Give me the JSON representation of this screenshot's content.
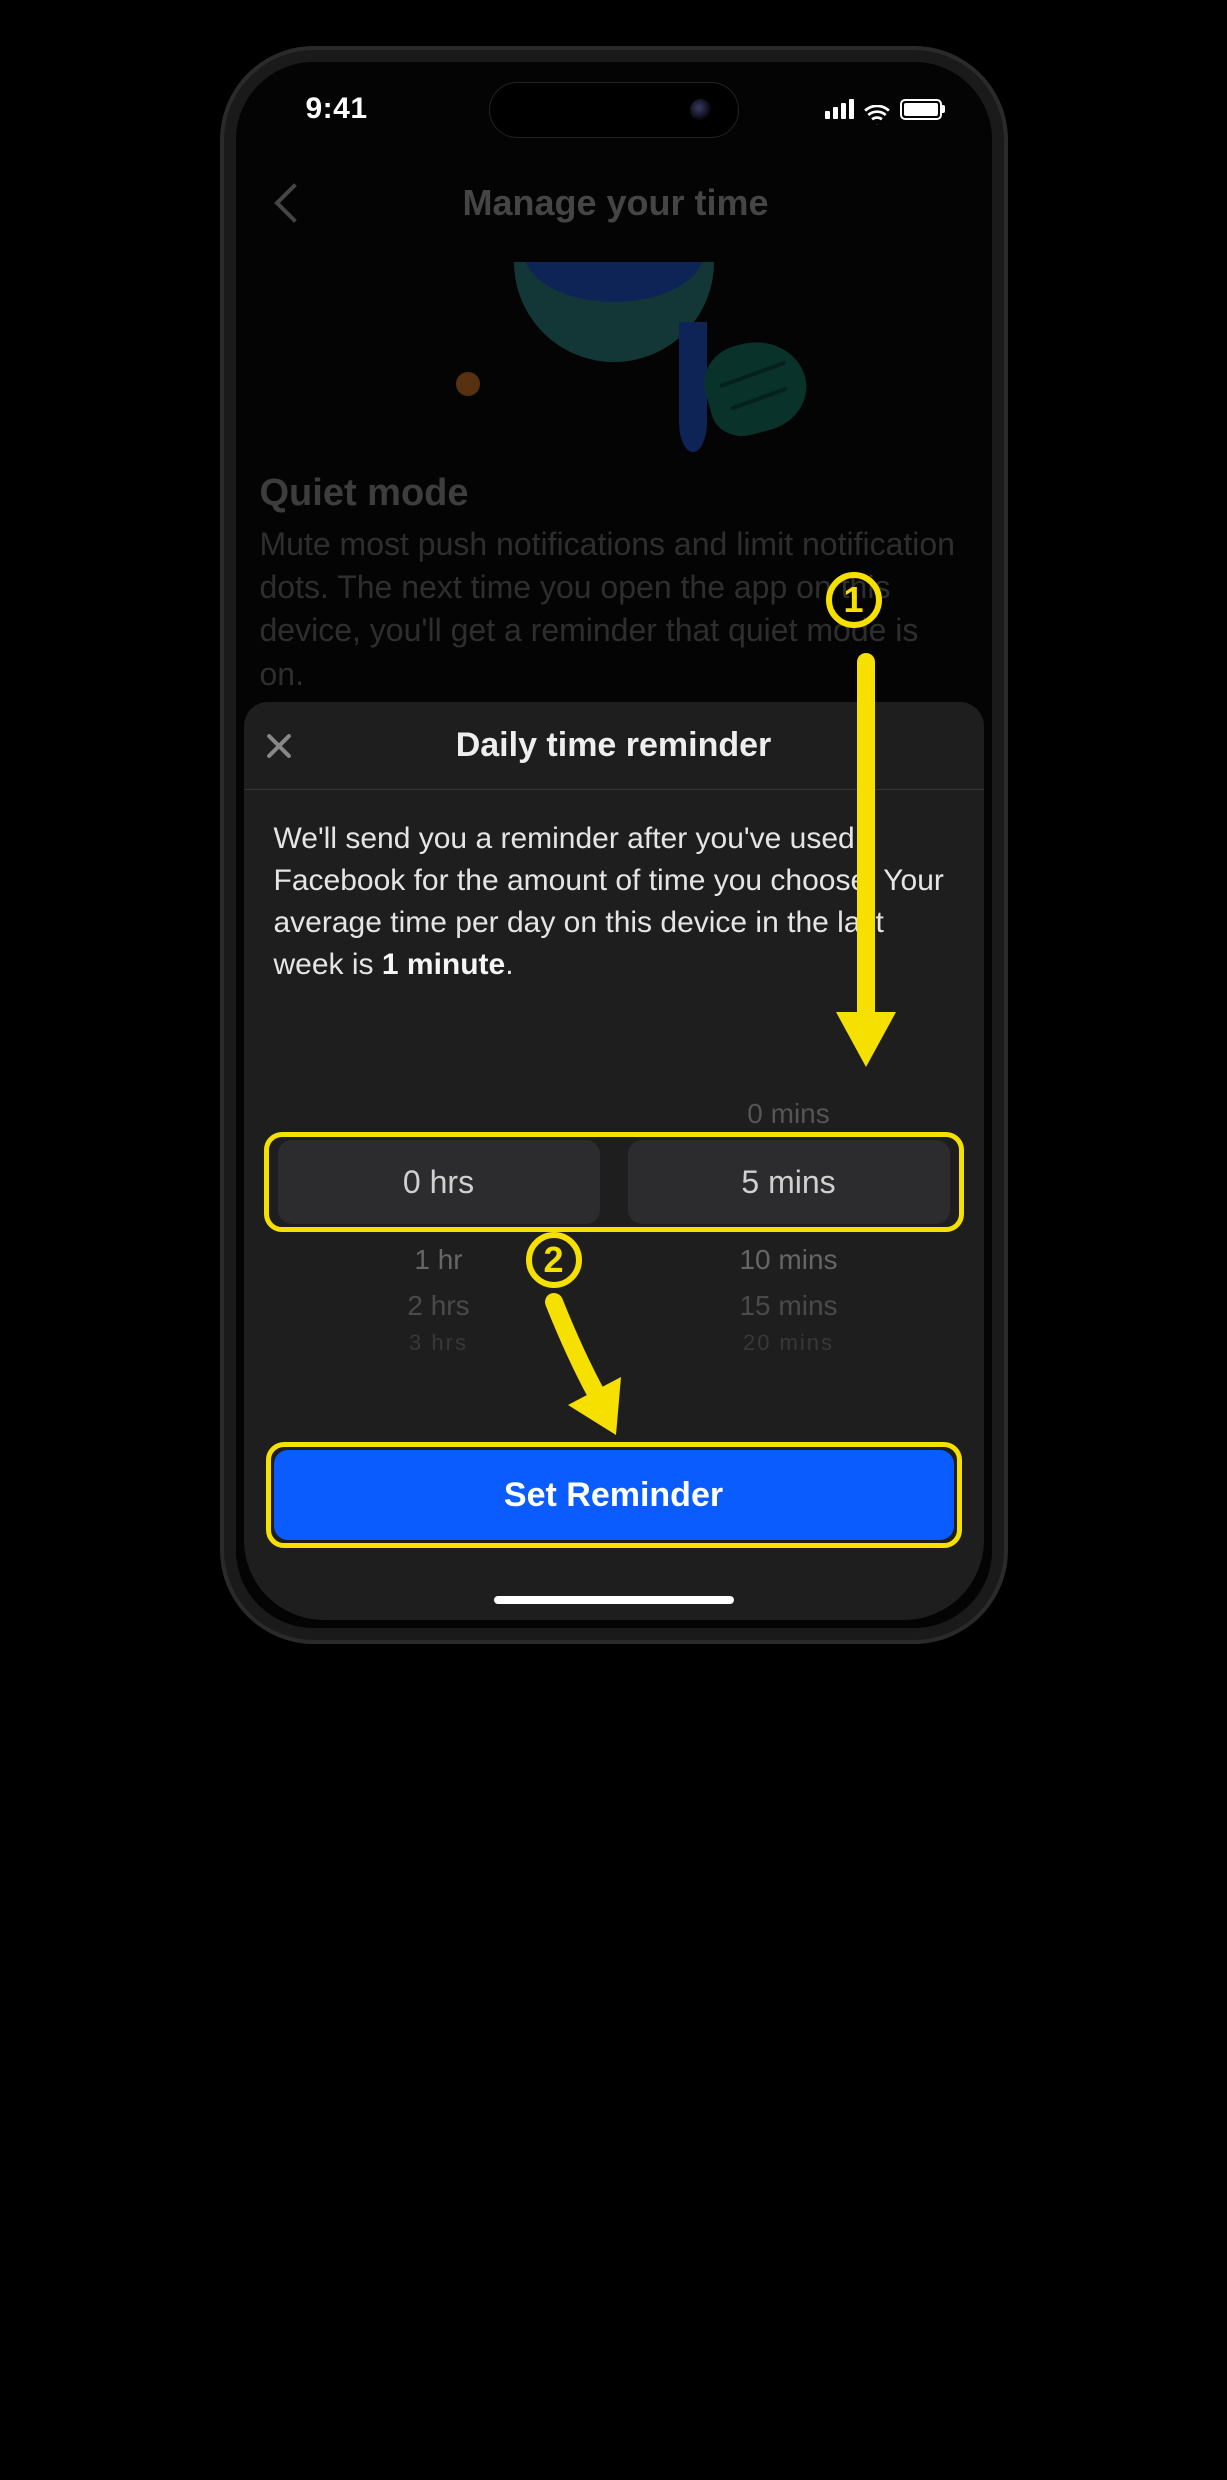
{
  "status_bar": {
    "time": "9:41"
  },
  "header": {
    "title": "Manage your time"
  },
  "quiet_mode": {
    "title": "Quiet mode",
    "description": "Mute most push notifications and limit notification dots. The next time you open the app on this device, you'll get a reminder that quiet mode is on."
  },
  "sheet": {
    "title": "Daily time reminder",
    "body_prefix": "We'll send you a reminder after you've used Facebook for the amount of time you choose. Your average time per day on this device in the last week is ",
    "body_bold": "1 minute",
    "body_suffix": "."
  },
  "picker": {
    "hours": {
      "selected": "0 hrs",
      "options_below": [
        "1 hr",
        "2 hrs",
        "3 hrs"
      ]
    },
    "minutes": {
      "option_above": "0 mins",
      "selected": "5 mins",
      "options_below": [
        "10 mins",
        "15 mins",
        "20 mins"
      ]
    }
  },
  "button": {
    "set_reminder": "Set Reminder"
  },
  "annotations": {
    "step1": "1",
    "step2": "2"
  }
}
